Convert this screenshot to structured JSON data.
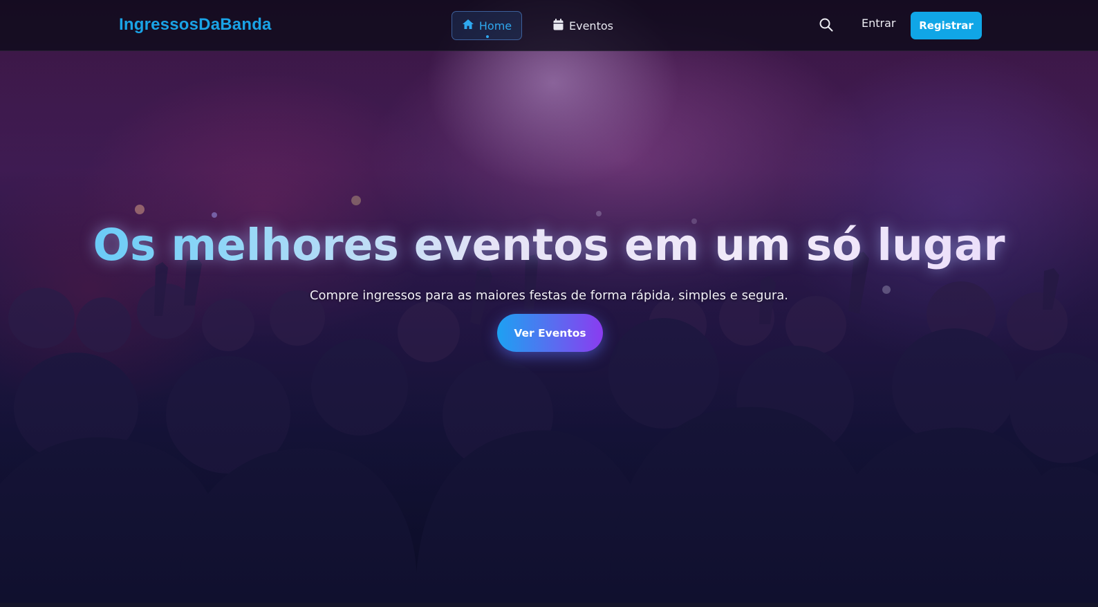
{
  "navbar": {
    "brand": "IngressosDaBanda",
    "links": [
      {
        "label": "Home",
        "icon": "home-icon",
        "active": true
      },
      {
        "label": "Eventos",
        "icon": "calendar-icon",
        "active": false
      }
    ],
    "search_icon": "search-icon",
    "login_label": "Entrar",
    "register_label": "Registrar"
  },
  "hero": {
    "title": "Os melhores eventos em um só lugar",
    "subtitle": "Compre ingressos para as maiores festas de forma rápida, simples e segura.",
    "cta_label": "Ver Eventos"
  },
  "colors": {
    "accent": "#10a6e6",
    "brand": "#1aa3e6",
    "cta_gradient_start": "#1da1f2",
    "cta_gradient_end": "#8a3cf0",
    "background": "#0b0b1e"
  }
}
